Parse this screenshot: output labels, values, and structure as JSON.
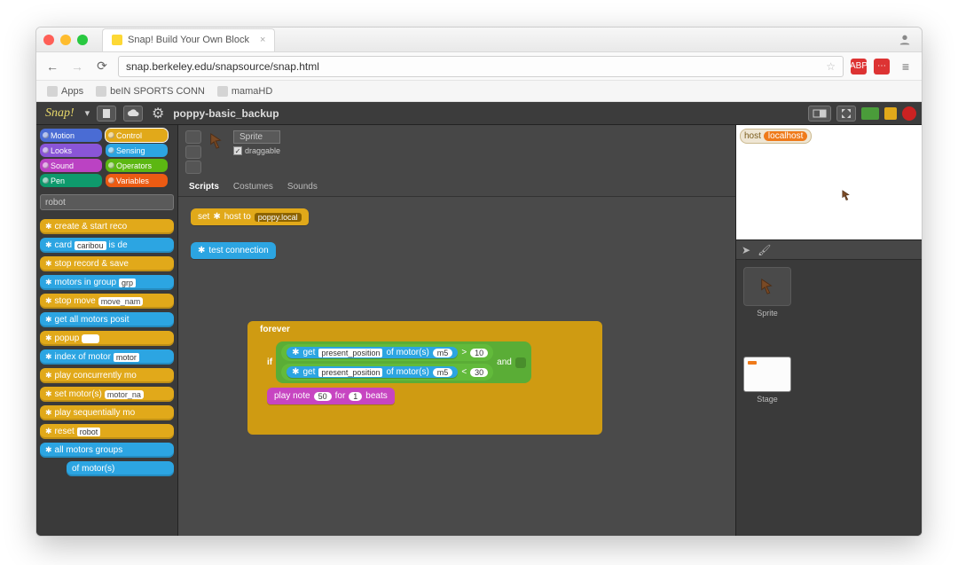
{
  "browser": {
    "tab_title": "Snap! Build Your Own Block",
    "url": "snap.berkeley.edu/snapsource/snap.html",
    "bookmarks": {
      "apps": "Apps",
      "bein": "beIN SPORTS CONN",
      "mama": "mamaHD"
    }
  },
  "appbar": {
    "logo": "Snap!",
    "project_title": "poppy-basic_backup"
  },
  "categories": {
    "motion": "Motion",
    "looks": "Looks",
    "sound": "Sound",
    "pen": "Pen",
    "control": "Control",
    "sensing": "Sensing",
    "operators": "Operators",
    "variables": "Variables"
  },
  "palette_search": "robot",
  "palette_blocks": {
    "create_rec": "create & start reco",
    "card": "card",
    "card_v": "caribou",
    "card_tail": "is de",
    "stop_rec": "stop record & save",
    "motors_grp": "motors in group",
    "motors_grp_v": "grp",
    "stop_move": "stop move",
    "stop_move_v": "move_nam",
    "get_all": "get all motors posit",
    "popup": "popup",
    "index": "index of motor",
    "index_v": "motor",
    "play_conc": "play concurrently mo",
    "set_motor": "set motor(s)",
    "set_motor_v": "motor_na",
    "play_seq": "play sequentially mo",
    "reset": "reset",
    "reset_v": "robot",
    "all_grp": "all motors groups",
    "of_motor": "of motor(s)"
  },
  "sprite": {
    "name": "Sprite",
    "draggable_label": "draggable",
    "tabs": {
      "scripts": "Scripts",
      "costumes": "Costumes",
      "sounds": "Sounds"
    }
  },
  "script": {
    "set_host_pre": "set",
    "set_host_mid": "host to",
    "set_host_val": "poppy.local",
    "test_conn": "test connection",
    "forever": "forever",
    "if": "if",
    "and": "and",
    "get": "get",
    "present_pos": "present_position",
    "of_motor": "of motor(s)",
    "m": "m5",
    "gt": ">",
    "gt_v": "10",
    "lt": "<",
    "lt_v": "30",
    "play_note": "play note",
    "note_v": "50",
    "for": "for",
    "beats_v": "1",
    "beats": "beats"
  },
  "stage": {
    "host_var": "host",
    "host_val": "localhost"
  },
  "corral": {
    "sprite": "Sprite",
    "stage": "Stage"
  }
}
